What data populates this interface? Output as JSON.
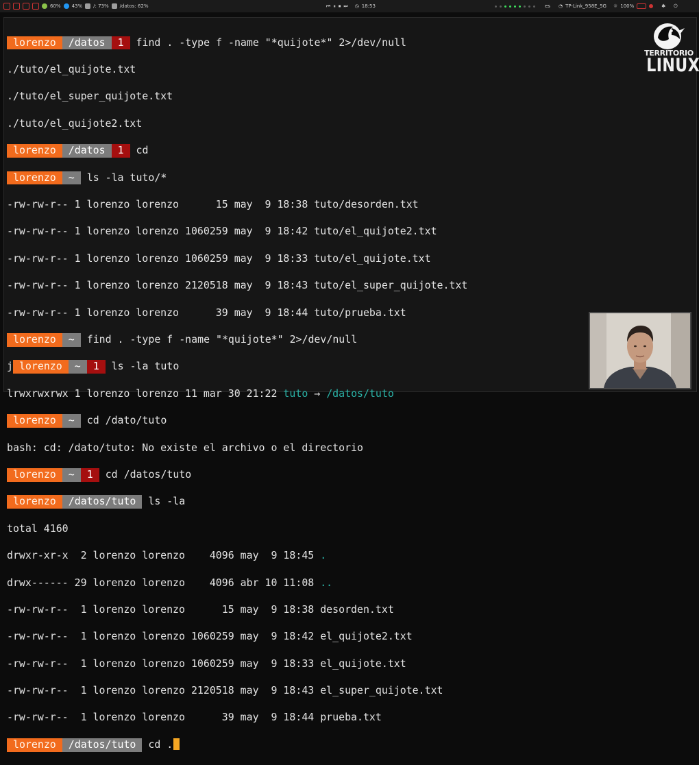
{
  "topbar": {
    "cpu": "60%",
    "mem": "43%",
    "disk_root": "/: 73%",
    "disk_datos": "/datos: 62%",
    "clock": "18:53",
    "lang": "es",
    "network": "TP-Link_958E_5G",
    "volume": "100%"
  },
  "logo": {
    "top": "TERRITORIO",
    "bottom": "LINUX"
  },
  "prompt": {
    "user": "lorenzo",
    "dir_datos": "/datos",
    "dir_home": "~",
    "dir_tuto": "/datos/tuto",
    "err_code": "1",
    "stray_char": "j"
  },
  "commands": {
    "find1": "find . -type f -name \"*quijote*\" 2>/dev/null",
    "cd_home": "cd",
    "ls_tuto_star": "ls -la tuto/*",
    "find2": "find . -type f -name \"*quijote*\" 2>/dev/null",
    "ls_tuto": "ls -la tuto",
    "cd_dato_tuto": "cd /dato/tuto",
    "cd_datos_tuto": "cd /datos/tuto",
    "ls_la": "ls -la",
    "cd_dot": "cd ."
  },
  "output": {
    "find_results": [
      "./tuto/el_quijote.txt",
      "./tuto/el_super_quijote.txt",
      "./tuto/el_quijote2.txt"
    ],
    "ls_tuto_star": [
      "-rw-rw-r-- 1 lorenzo lorenzo      15 may  9 18:38 tuto/desorden.txt",
      "-rw-rw-r-- 1 lorenzo lorenzo 1060259 may  9 18:42 tuto/el_quijote2.txt",
      "-rw-rw-r-- 1 lorenzo lorenzo 1060259 may  9 18:33 tuto/el_quijote.txt",
      "-rw-rw-r-- 1 lorenzo lorenzo 2120518 may  9 18:43 tuto/el_super_quijote.txt",
      "-rw-rw-r-- 1 lorenzo lorenzo      39 may  9 18:44 tuto/prueba.txt"
    ],
    "symlink_prefix": "lrwxrwxrwx 1 lorenzo lorenzo 11 mar 30 21:22 ",
    "symlink_name": "tuto",
    "symlink_arrow": " → ",
    "symlink_target": "/datos/tuto",
    "cd_error": "bash: cd: /dato/tuto: No existe el archivo o el directorio",
    "total": "total 4160",
    "dir_dot_prefix": "drwxr-xr-x  2 lorenzo lorenzo    4096 may  9 18:45 ",
    "dir_dot_name": ".",
    "dir_dotdot_prefix": "drwx------ 29 lorenzo lorenzo    4096 abr 10 11:08 ",
    "dir_dotdot_name": "..",
    "ls_la_files": [
      "-rw-rw-r--  1 lorenzo lorenzo      15 may  9 18:38 desorden.txt",
      "-rw-rw-r--  1 lorenzo lorenzo 1060259 may  9 18:42 el_quijote2.txt",
      "-rw-rw-r--  1 lorenzo lorenzo 1060259 may  9 18:33 el_quijote.txt",
      "-rw-rw-r--  1 lorenzo lorenzo 2120518 may  9 18:43 el_super_quijote.txt",
      "-rw-rw-r--  1 lorenzo lorenzo      39 may  9 18:44 prueba.txt"
    ]
  },
  "colors": {
    "user_bg": "#f26b1d",
    "dir_bg": "#7c7c7c",
    "error_bg": "#a50f0f",
    "link_color": "#2bb5a9",
    "cursor": "#f5a623"
  }
}
